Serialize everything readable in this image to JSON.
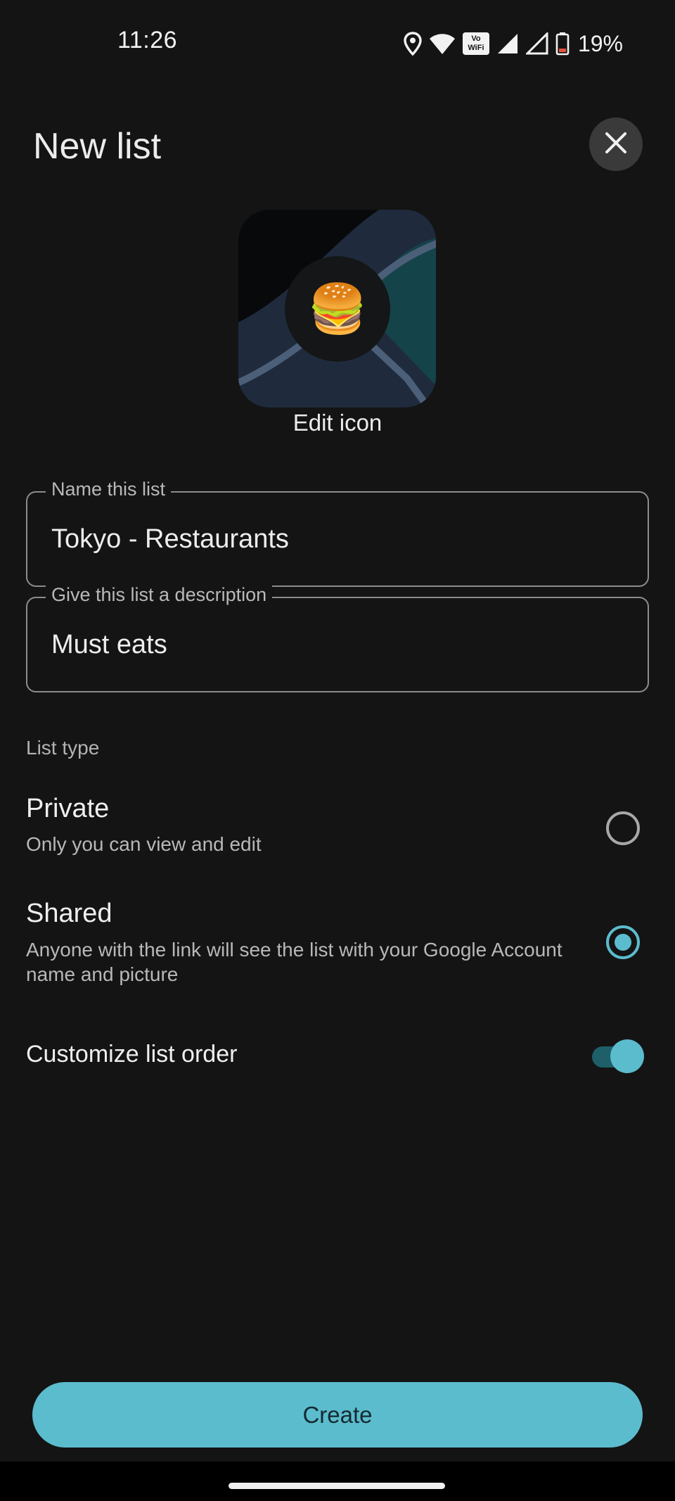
{
  "status_bar": {
    "time": "11:26",
    "battery_percent": "19%",
    "volte_label_top": "Vo",
    "volte_label_bottom": "WiFi",
    "icons": [
      "location-icon",
      "wifi-icon",
      "volte-wifi-icon",
      "signal-icon",
      "signal-icon",
      "battery-icon"
    ]
  },
  "header": {
    "title": "New list",
    "close_icon": "close-icon"
  },
  "list_icon": {
    "emoji": "🍔",
    "edit_label": "Edit icon"
  },
  "form": {
    "name_field": {
      "label": "Name this list",
      "value": "Tokyo - Restaurants"
    },
    "description_field": {
      "label": "Give this list a description",
      "value": "Must eats"
    }
  },
  "list_type": {
    "section_label": "List type",
    "options": [
      {
        "title": "Private",
        "description": "Only you can view and edit",
        "selected": false
      },
      {
        "title": "Shared",
        "description": "Anyone with the link will see the list with your Google Account name and picture",
        "selected": true
      }
    ]
  },
  "customize_order": {
    "label": "Customize list order",
    "enabled": true
  },
  "actions": {
    "create_label": "Create"
  },
  "colors": {
    "background": "#141414",
    "accent": "#5bbccd",
    "accent_dark": "#1e5f69",
    "field_border": "#8c8c8c"
  }
}
